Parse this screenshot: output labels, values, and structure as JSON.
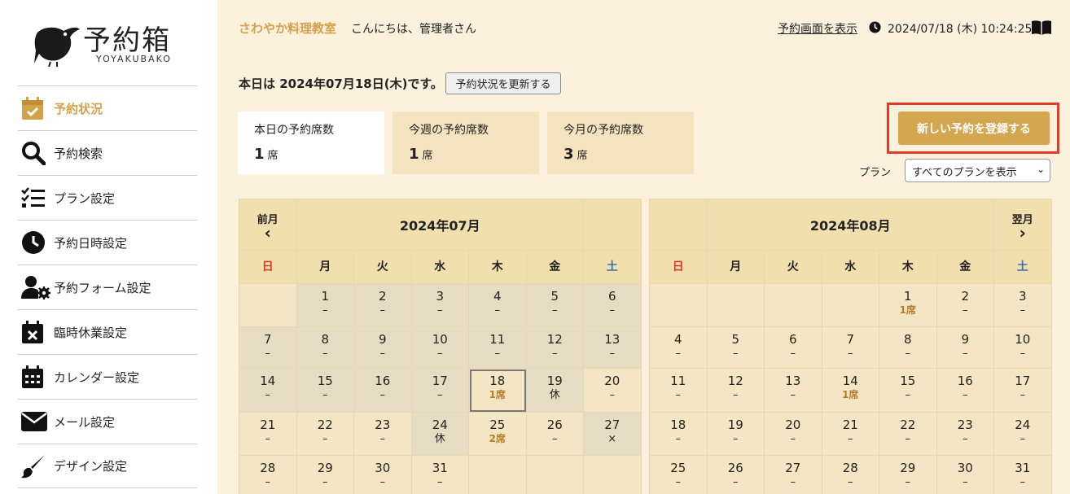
{
  "logo": {
    "title": "予約箱",
    "subtitle": "YOYAKUBAKO"
  },
  "sidebar": {
    "items": [
      {
        "label": "予約状況",
        "icon": "calendar-check-icon",
        "active": true
      },
      {
        "label": "予約検索",
        "icon": "search-icon"
      },
      {
        "label": "プラン設定",
        "icon": "checklist-icon"
      },
      {
        "label": "予約日時設定",
        "icon": "clock-icon"
      },
      {
        "label": "予約フォーム設定",
        "icon": "user-gear-icon"
      },
      {
        "label": "臨時休業設定",
        "icon": "calendar-x-icon"
      },
      {
        "label": "カレンダー設定",
        "icon": "calendar-grid-icon"
      },
      {
        "label": "メール設定",
        "icon": "envelope-icon"
      },
      {
        "label": "デザイン設定",
        "icon": "brush-icon"
      }
    ]
  },
  "header": {
    "school": "さわやか料理教室",
    "greeting": "こんにちは、管理者さん",
    "view_link": "予約画面を表示",
    "datetime": "2024/07/18 (木) 10:24:25"
  },
  "today": {
    "text": "本日は 2024年07月18日(木)です。",
    "refresh_label": "予約状況を更新する"
  },
  "stats": [
    {
      "label": "本日の予約席数",
      "value": "1",
      "unit": "席"
    },
    {
      "label": "今週の予約席数",
      "value": "1",
      "unit": "席"
    },
    {
      "label": "今月の予約席数",
      "value": "3",
      "unit": "席"
    }
  ],
  "new_button": "新しい予約を登録する",
  "plan": {
    "label": "プラン",
    "selected": "すべてのプランを表示"
  },
  "weekdays": [
    "日",
    "月",
    "火",
    "水",
    "木",
    "金",
    "土"
  ],
  "calendars": [
    {
      "title": "2024年07月",
      "prev_label": "前月",
      "prev_arrow": "‹",
      "next_label": "",
      "weeks": [
        [
          [
            "",
            ""
          ],
          [
            "1",
            "–"
          ],
          [
            "2",
            "–"
          ],
          [
            "3",
            "–"
          ],
          [
            "4",
            "–"
          ],
          [
            "5",
            "–"
          ],
          [
            "6",
            "–"
          ]
        ],
        [
          [
            "7",
            "–"
          ],
          [
            "8",
            "–"
          ],
          [
            "9",
            "–"
          ],
          [
            "10",
            "–"
          ],
          [
            "11",
            "–"
          ],
          [
            "12",
            "–"
          ],
          [
            "13",
            "–"
          ]
        ],
        [
          [
            "14",
            "–"
          ],
          [
            "15",
            "–"
          ],
          [
            "16",
            "–"
          ],
          [
            "17",
            "–"
          ],
          [
            "18",
            "1席"
          ],
          [
            "19",
            "休"
          ],
          [
            "20",
            "–"
          ]
        ],
        [
          [
            "21",
            "–"
          ],
          [
            "22",
            "–"
          ],
          [
            "23",
            "–"
          ],
          [
            "24",
            "休"
          ],
          [
            "25",
            "2席"
          ],
          [
            "26",
            "–"
          ],
          [
            "27",
            "×"
          ]
        ],
        [
          [
            "28",
            "–"
          ],
          [
            "29",
            "–"
          ],
          [
            "30",
            "–"
          ],
          [
            "31",
            "–"
          ],
          [
            "",
            ""
          ],
          [
            "",
            ""
          ],
          [
            "",
            ""
          ]
        ]
      ]
    },
    {
      "title": "2024年08月",
      "prev_label": "",
      "next_label": "翌月",
      "next_arrow": "›",
      "weeks": [
        [
          [
            "",
            ""
          ],
          [
            "",
            ""
          ],
          [
            "",
            ""
          ],
          [
            "",
            ""
          ],
          [
            "1",
            "1席"
          ],
          [
            "2",
            "–"
          ],
          [
            "3",
            "–"
          ]
        ],
        [
          [
            "4",
            "–"
          ],
          [
            "5",
            "–"
          ],
          [
            "6",
            "–"
          ],
          [
            "7",
            "–"
          ],
          [
            "8",
            "–"
          ],
          [
            "9",
            "–"
          ],
          [
            "10",
            "–"
          ]
        ],
        [
          [
            "11",
            "–"
          ],
          [
            "12",
            "–"
          ],
          [
            "13",
            "–"
          ],
          [
            "14",
            "1席"
          ],
          [
            "15",
            "–"
          ],
          [
            "16",
            "–"
          ],
          [
            "17",
            "–"
          ]
        ],
        [
          [
            "18",
            "–"
          ],
          [
            "19",
            "–"
          ],
          [
            "20",
            "–"
          ],
          [
            "21",
            "–"
          ],
          [
            "22",
            "–"
          ],
          [
            "23",
            "–"
          ],
          [
            "24",
            "–"
          ]
        ],
        [
          [
            "25",
            "–"
          ],
          [
            "26",
            "–"
          ],
          [
            "27",
            "–"
          ],
          [
            "28",
            "–"
          ],
          [
            "29",
            "–"
          ],
          [
            "30",
            "–"
          ],
          [
            "31",
            "–"
          ]
        ]
      ]
    }
  ],
  "colors": {
    "accent": "#d4a24a",
    "button": "#d4a64f",
    "highlight_frame": "#e33a2a",
    "sunday": "#d83a2a",
    "saturday": "#3d6fb0"
  }
}
